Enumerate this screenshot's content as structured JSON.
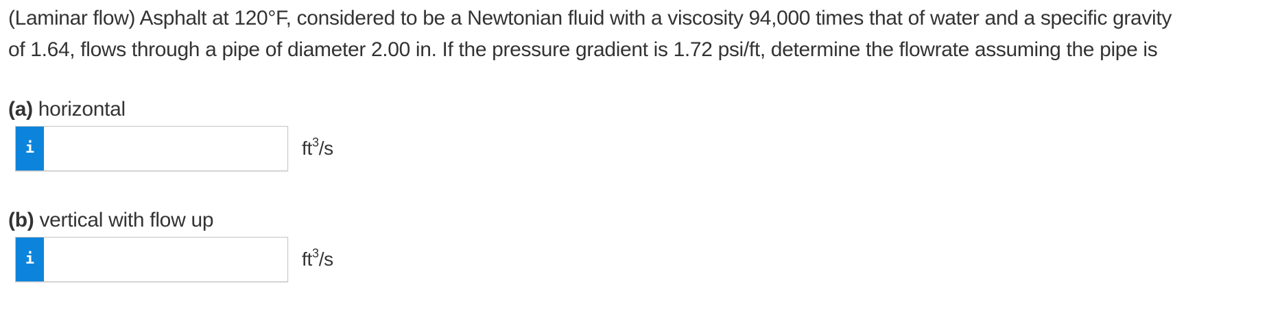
{
  "problem": {
    "line1": "(Laminar flow) Asphalt at 120°F, considered to be a Newtonian fluid with a viscosity 94,000 times that of water and a specific gravity",
    "line2": "of 1.64, flows through a pipe of diameter 2.00 in. If the pressure gradient is 1.72 psi/ft, determine the flowrate assuming the pipe is"
  },
  "parts": {
    "a": {
      "letter": "(a)",
      "label": " horizontal",
      "info_icon_text": "i",
      "input_value": "",
      "unit_base": "ft",
      "unit_exponent": "3",
      "unit_suffix": "/s"
    },
    "b": {
      "letter": "(b)",
      "label": " vertical with flow up",
      "info_icon_text": "i",
      "input_value": "",
      "unit_base": "ft",
      "unit_exponent": "3",
      "unit_suffix": "/s"
    }
  },
  "colors": {
    "info_button": "#0c84dc",
    "text": "#333333",
    "input_border": "#c4c4c4"
  }
}
